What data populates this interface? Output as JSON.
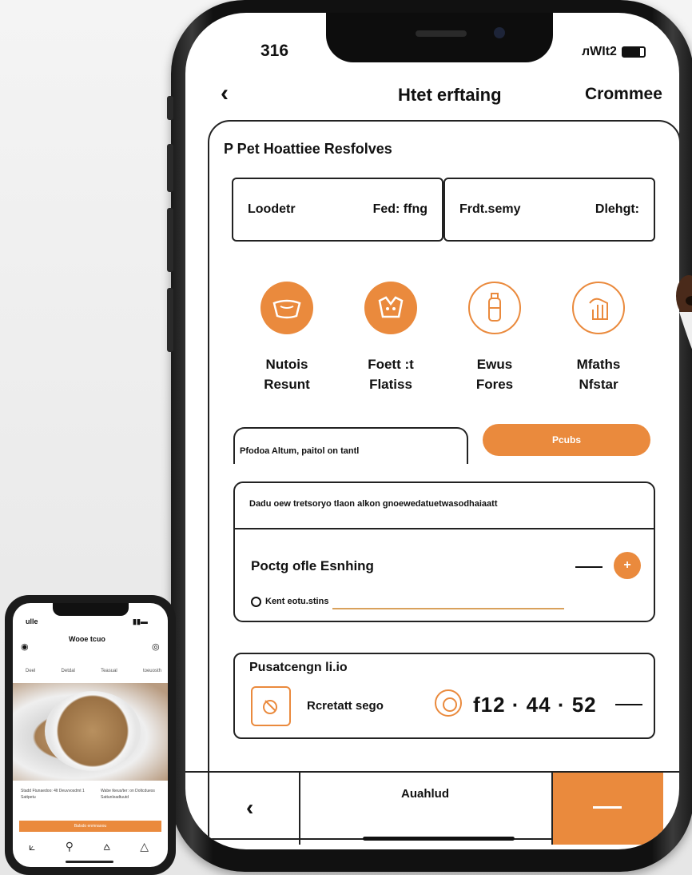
{
  "status": {
    "time": "316",
    "carrier": "лWIt2"
  },
  "header": {
    "back_icon": "chevron-left-icon",
    "title": "Htet erftaing",
    "action": "Crommee"
  },
  "section": {
    "title": "P Pet Hoattiee Resfolves"
  },
  "tabs": [
    {
      "left": "Loodetr",
      "right": "Fed: ffng"
    },
    {
      "left": "Frdt.semy",
      "right": "Dlehgt:"
    }
  ],
  "categories": [
    {
      "line1": "Nutois",
      "line2": "Resunt",
      "icon": "food-bowl-icon",
      "style": "filled"
    },
    {
      "line1": "Foett :t",
      "line2": "Flatiss",
      "icon": "pet-food-icon",
      "style": "filled"
    },
    {
      "line1": "Ewus",
      "line2": "Fores",
      "icon": "bottle-icon",
      "style": "outline"
    },
    {
      "line1": "Mfaths",
      "line2": "Nfstar",
      "icon": "pet-hand-icon",
      "style": "outline"
    }
  ],
  "search": {
    "text": "Pfodoa Altum, paitol on tantl",
    "button": "Pcubs"
  },
  "info": {
    "description": "Dadu oew tretsoryo tlaon alkon gnoewedatuetwasodhaiaatt",
    "heading": "Poctg ofle Esnhing",
    "plus": "+",
    "radio_label": "Kent eotu.stins"
  },
  "schedule": {
    "title": "Pusatcengn li.io",
    "label": "Rcretatt sego",
    "time": "f12 · 44 · 52"
  },
  "bottom": {
    "back": "‹",
    "center": "Auahlud"
  },
  "mini": {
    "time": "ulle",
    "title": "Wooe tcuo",
    "tabs": [
      "Deel",
      "Detdal",
      "Teasual",
      "toeuosth"
    ],
    "text_left": "Stadd Ftunaedoo: 4lt Deuvvosdmt 1 Sattpetu",
    "text_right": "Wabe tkeus/ter: on Doltcduess Sattunleadtuutd",
    "button": "Balsdo enmnaoou"
  },
  "colors": {
    "accent": "#ea8a3d",
    "ink": "#111111"
  }
}
